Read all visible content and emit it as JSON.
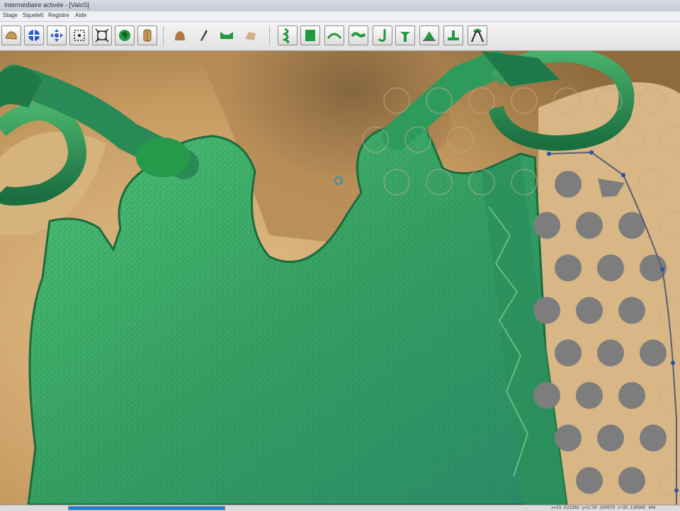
{
  "window": {
    "title": "Intermédiaire activée - [ValoS]"
  },
  "menu": {
    "items": [
      "Stage",
      "Squelett",
      "Registre",
      "Aide"
    ]
  },
  "toolbar": {
    "buttons": [
      {
        "icon": "open-model-icon"
      },
      {
        "icon": "rotate-view-icon"
      },
      {
        "icon": "move-view-icon"
      },
      {
        "icon": "zoom-region-icon"
      },
      {
        "icon": "fit-view-icon"
      },
      {
        "icon": "color-model-icon"
      },
      {
        "icon": "section-icon"
      },
      {
        "icon": "wax-model-icon"
      },
      {
        "icon": "pen-tool-icon"
      },
      {
        "icon": "framework-icon"
      },
      {
        "icon": "model-piece-icon"
      },
      {
        "icon": "retention-grid-icon"
      },
      {
        "icon": "plate-icon"
      },
      {
        "icon": "arch-connector-icon"
      },
      {
        "icon": "bar-icon"
      },
      {
        "icon": "clasp-icon"
      },
      {
        "icon": "rest-icon"
      },
      {
        "icon": "tooth-icon"
      },
      {
        "icon": "support-icon"
      },
      {
        "icon": "bridge-icon"
      }
    ]
  },
  "viewport": {
    "label": "3D model view"
  },
  "status": {
    "progress": 1.0,
    "coordinates": "x=23.631369 y=1/30 100079   z=35.130068 406"
  },
  "colors": {
    "model_gold": "#c9a36b",
    "framework_green": "#3aa565",
    "retention_dot": "#7a7a7a",
    "progress_blue": "#1a7fd8"
  }
}
